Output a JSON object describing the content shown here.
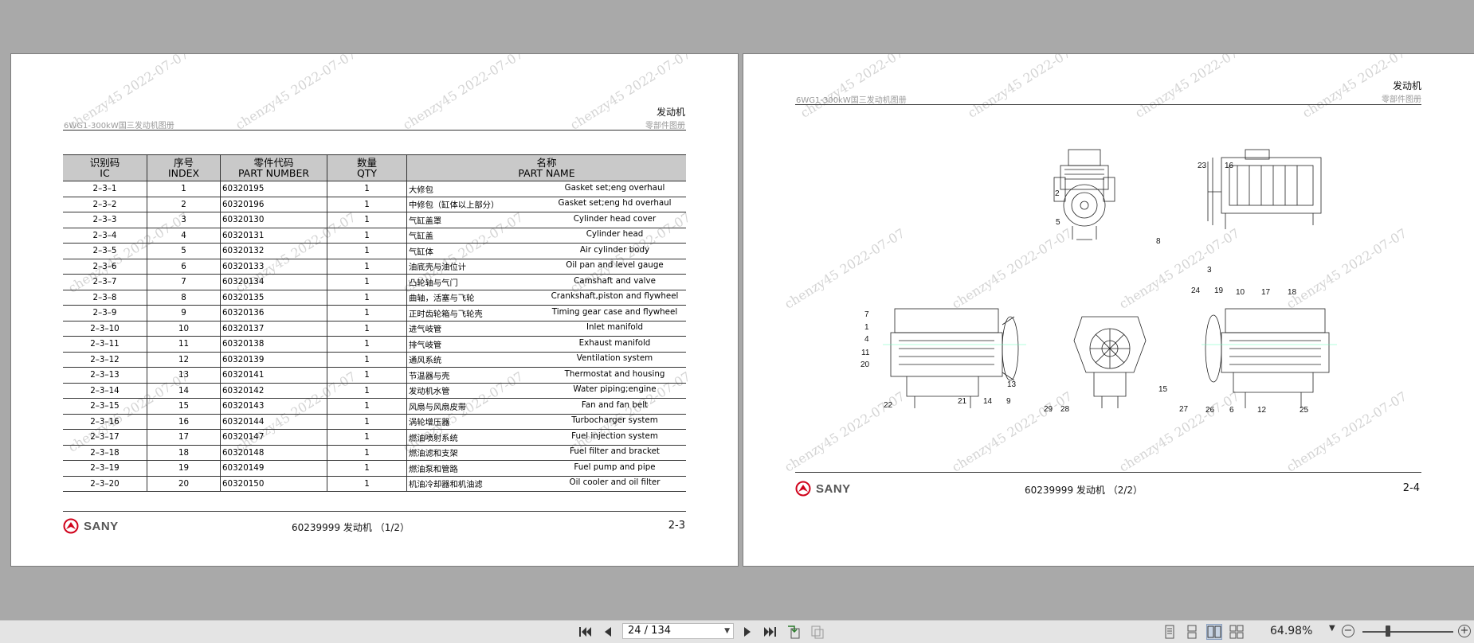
{
  "watermark": "chenzy45 2022-07-07",
  "left_page": {
    "header_sub": "6WG1-300kW国三发动机图册",
    "header_title": "发动机",
    "header_title_sub": "零部件图册",
    "table": {
      "headers": [
        {
          "cn": "识别码",
          "en": "IC"
        },
        {
          "cn": "序号",
          "en": "INDEX"
        },
        {
          "cn": "零件代码",
          "en": "PART NUMBER"
        },
        {
          "cn": "数量",
          "en": "QTY"
        },
        {
          "cn": "名称",
          "en": "PART NAME"
        }
      ],
      "rows": [
        {
          "ic": "2–3–1",
          "index": "1",
          "pn": "60320195",
          "qty": "1",
          "cn": "大修包",
          "en": "Gasket set;eng overhaul"
        },
        {
          "ic": "2–3–2",
          "index": "2",
          "pn": "60320196",
          "qty": "1",
          "cn": "中修包（缸体以上部分）",
          "en": "Gasket set;eng hd overhaul"
        },
        {
          "ic": "2–3–3",
          "index": "3",
          "pn": "60320130",
          "qty": "1",
          "cn": "气缸盖罩",
          "en": "Cylinder head cover"
        },
        {
          "ic": "2–3–4",
          "index": "4",
          "pn": "60320131",
          "qty": "1",
          "cn": "气缸盖",
          "en": "Cylinder head"
        },
        {
          "ic": "2–3–5",
          "index": "5",
          "pn": "60320132",
          "qty": "1",
          "cn": "气缸体",
          "en": "Air cylinder body"
        },
        {
          "ic": "2–3–6",
          "index": "6",
          "pn": "60320133",
          "qty": "1",
          "cn": "油底壳与油位计",
          "en": "Oil pan and level gauge"
        },
        {
          "ic": "2–3–7",
          "index": "7",
          "pn": "60320134",
          "qty": "1",
          "cn": "凸轮轴与气门",
          "en": "Camshaft and valve"
        },
        {
          "ic": "2–3–8",
          "index": "8",
          "pn": "60320135",
          "qty": "1",
          "cn": "曲轴，活塞与飞轮",
          "en": "Crankshaft,piston and flywheel"
        },
        {
          "ic": "2–3–9",
          "index": "9",
          "pn": "60320136",
          "qty": "1",
          "cn": "正时齿轮箱与飞轮壳",
          "en": "Timing gear case and flywheel"
        },
        {
          "ic": "2–3–10",
          "index": "10",
          "pn": "60320137",
          "qty": "1",
          "cn": "进气岐管",
          "en": "Inlet manifold"
        },
        {
          "ic": "2–3–11",
          "index": "11",
          "pn": "60320138",
          "qty": "1",
          "cn": "排气岐管",
          "en": "Exhaust manifold"
        },
        {
          "ic": "2–3–12",
          "index": "12",
          "pn": "60320139",
          "qty": "1",
          "cn": "通风系统",
          "en": "Ventilation system"
        },
        {
          "ic": "2–3–13",
          "index": "13",
          "pn": "60320141",
          "qty": "1",
          "cn": "节温器与壳",
          "en": "Thermostat and housing"
        },
        {
          "ic": "2–3–14",
          "index": "14",
          "pn": "60320142",
          "qty": "1",
          "cn": "发动机水管",
          "en": "Water piping;engine"
        },
        {
          "ic": "2–3–15",
          "index": "15",
          "pn": "60320143",
          "qty": "1",
          "cn": "风扇与风扇皮带",
          "en": "Fan and fan belt"
        },
        {
          "ic": "2–3–16",
          "index": "16",
          "pn": "60320144",
          "qty": "1",
          "cn": "涡轮增压器",
          "en": "Turbocharger system"
        },
        {
          "ic": "2–3–17",
          "index": "17",
          "pn": "60320147",
          "qty": "1",
          "cn": "燃油喷射系统",
          "en": "Fuel injection system"
        },
        {
          "ic": "2–3–18",
          "index": "18",
          "pn": "60320148",
          "qty": "1",
          "cn": "燃油滤和支架",
          "en": "Fuel filter and bracket"
        },
        {
          "ic": "2–3–19",
          "index": "19",
          "pn": "60320149",
          "qty": "1",
          "cn": "燃油泵和管路",
          "en": "Fuel pump and pipe"
        },
        {
          "ic": "2–3–20",
          "index": "20",
          "pn": "60320150",
          "qty": "1",
          "cn": "机油冷却器和机油滤",
          "en": "Oil cooler and oil filter"
        }
      ]
    },
    "footer_logo": "SANY",
    "footer_center": "60239999  发动机 （1/2）",
    "footer_page": "2-3"
  },
  "right_page": {
    "header_sub": "6WG1-300kW国三发动机图册",
    "header_title": "发动机",
    "header_title_sub": "零部件图册",
    "callouts": [
      "2",
      "5",
      "8",
      "23",
      "16",
      "3",
      "7",
      "1",
      "4",
      "11",
      "20",
      "22",
      "21",
      "14",
      "9",
      "13",
      "29",
      "28",
      "15",
      "24",
      "19",
      "10",
      "17",
      "18",
      "27",
      "26",
      "6",
      "12",
      "25"
    ],
    "footer_logo": "SANY",
    "footer_center": "60239999  发动机 （2/2）",
    "footer_page": "2-4"
  },
  "toolbar": {
    "page_indicator": "24 / 134",
    "zoom": "64.98%",
    "zoom_level_fraction": 0.28
  }
}
